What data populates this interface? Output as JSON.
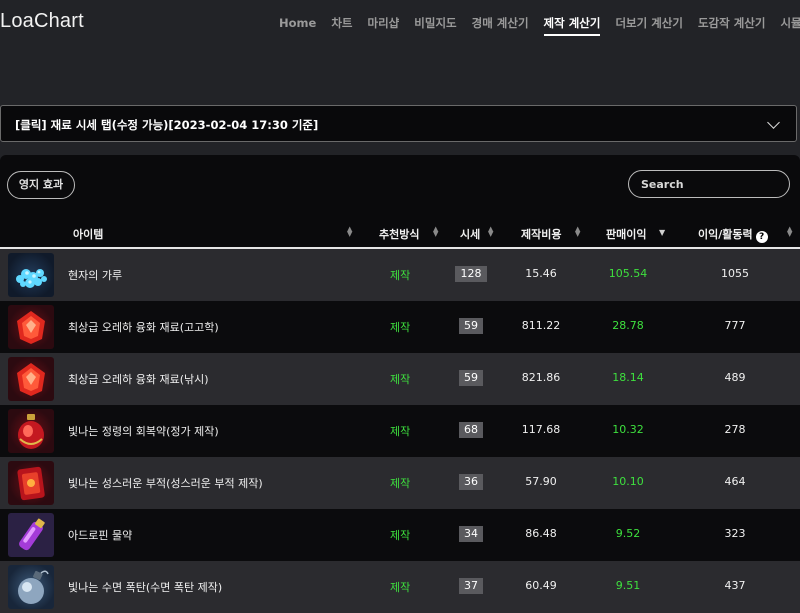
{
  "app": {
    "title": "LoaChart"
  },
  "nav": {
    "items": [
      "Home",
      "차트",
      "마리샵",
      "비밀지도",
      "경매 계산기",
      "제작 계산기",
      "더보기 계산기",
      "도감작 계산기",
      "시뮬레이션"
    ],
    "active": "제작 계산기"
  },
  "price_tab": {
    "label": "[클릭] 재료 시세 탭(수정 가능)[2023-02-04 17:30 기준]"
  },
  "toolbar": {
    "territory_button": "영지 효과",
    "search_placeholder": "Search"
  },
  "table": {
    "headers": {
      "item": "아이템",
      "method": "추천방식",
      "price": "시세",
      "cost": "제작비용",
      "profit": "판매이익",
      "ratio": "이익/활동력",
      "help": "?"
    },
    "rows": [
      {
        "icon": "crystal-dust-icon",
        "name": "현자의 가루",
        "method": "제작",
        "price": "128",
        "cost": "15.46",
        "profit": "105.54",
        "ratio": "1055"
      },
      {
        "icon": "fusion-material-icon",
        "name": "최상급 오레하 융화 재료(고고학)",
        "method": "제작",
        "price": "59",
        "cost": "811.22",
        "profit": "28.78",
        "ratio": "777"
      },
      {
        "icon": "fusion-material-icon",
        "name": "최상급 오레하 융화 재료(낚시)",
        "method": "제작",
        "price": "59",
        "cost": "821.86",
        "profit": "18.14",
        "ratio": "489"
      },
      {
        "icon": "potion-icon",
        "name": "빛나는 정령의 회복약(정가 제작)",
        "method": "제작",
        "price": "68",
        "cost": "117.68",
        "profit": "10.32",
        "ratio": "278"
      },
      {
        "icon": "talisman-icon",
        "name": "빛나는 성스러운 부적(성스러운 부적 제작)",
        "method": "제작",
        "price": "36",
        "cost": "57.90",
        "profit": "10.10",
        "ratio": "464"
      },
      {
        "icon": "vial-icon",
        "name": "아드로핀 물약",
        "method": "제작",
        "price": "34",
        "cost": "86.48",
        "profit": "9.52",
        "ratio": "323"
      },
      {
        "icon": "bomb-icon",
        "name": "빛나는 수면 폭탄(수면 폭탄 제작)",
        "method": "제작",
        "price": "37",
        "cost": "60.49",
        "profit": "9.51",
        "ratio": "437"
      }
    ]
  },
  "colors": {
    "profit": "#3ee03e",
    "method": "#3ee03e",
    "row_alt": "#2b2b2f",
    "background": "#222327"
  }
}
